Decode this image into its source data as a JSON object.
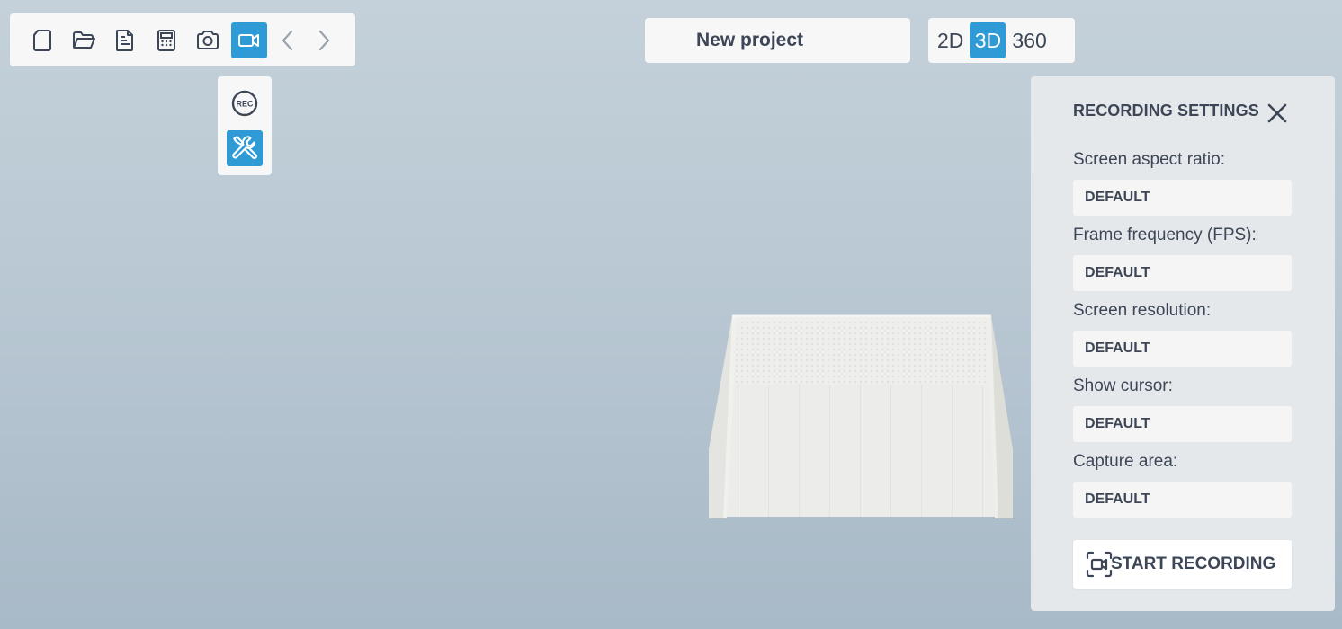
{
  "toolbar": {
    "tools": [
      {
        "icon": "new-file-icon"
      },
      {
        "icon": "open-folder-icon"
      },
      {
        "icon": "document-icon"
      },
      {
        "icon": "calculator-icon"
      },
      {
        "icon": "camera-icon"
      },
      {
        "icon": "video-camera-icon",
        "active": true
      },
      {
        "icon": "undo-arrow-icon"
      },
      {
        "icon": "redo-arrow-icon"
      }
    ]
  },
  "subtools": {
    "rec_label": "REC",
    "settings_icon": "tools-icon"
  },
  "project": {
    "title": "New project"
  },
  "view_modes": {
    "opt_2d": "2D",
    "opt_3d": "3D",
    "opt_360": "360",
    "active": "3D"
  },
  "recording_settings": {
    "title": "RECORDING SETTINGS",
    "fields": [
      {
        "label": "Screen aspect ratio:",
        "value": "DEFAULT"
      },
      {
        "label": "Frame frequency (FPS):",
        "value": "DEFAULT"
      },
      {
        "label": "Screen resolution:",
        "value": "DEFAULT"
      },
      {
        "label": "Show cursor:",
        "value": "DEFAULT"
      },
      {
        "label": "Capture area:",
        "value": "DEFAULT"
      }
    ],
    "start_label": "START RECORDING"
  },
  "colors": {
    "accent": "#2e9ad6",
    "text": "#3d4656",
    "panel": "#e5e8eb"
  }
}
